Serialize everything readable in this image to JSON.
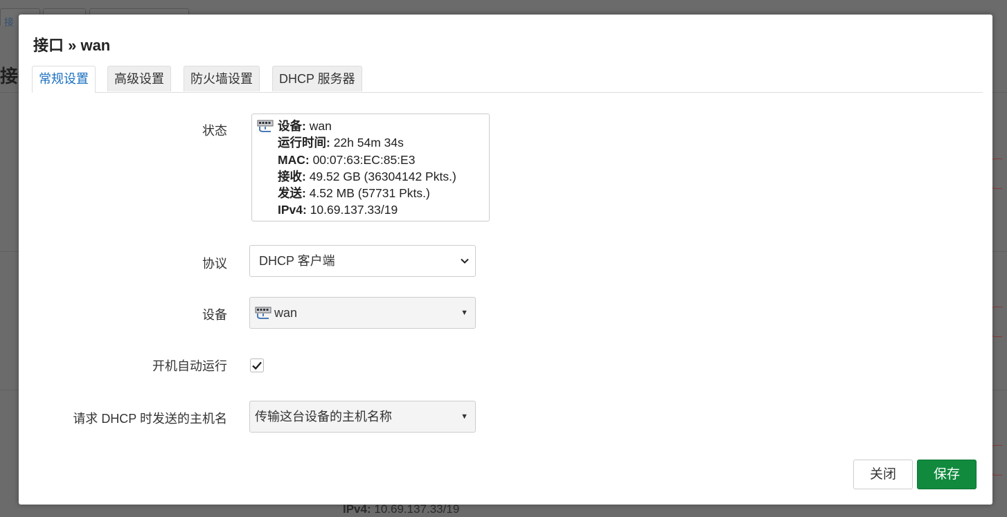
{
  "background": {
    "tab_fragment": "接",
    "page_title_fragment": "接",
    "ipv4_label": "IPv4:",
    "ipv4_value": "10.69.137.33/19"
  },
  "modal": {
    "title": "接口 » wan",
    "tabs": [
      {
        "label": "常规设置",
        "active": true
      },
      {
        "label": "高级设置",
        "active": false
      },
      {
        "label": "防火墙设置",
        "active": false
      },
      {
        "label": "DHCP 服务器",
        "active": false
      }
    ],
    "status": {
      "label": "状态",
      "icon": "ethernet-port-icon",
      "lines": [
        {
          "key": "设备:",
          "value": "wan"
        },
        {
          "key": "运行时间:",
          "value": "22h 54m 34s"
        },
        {
          "key": "MAC:",
          "value": "00:07:63:EC:85:E3"
        },
        {
          "key": "接收:",
          "value": "49.52 GB (36304142 Pkts.)"
        },
        {
          "key": "发送:",
          "value": "4.52 MB (57731 Pkts.)"
        },
        {
          "key": "IPv4:",
          "value": "10.69.137.33/19"
        }
      ]
    },
    "protocol": {
      "label": "协议",
      "value": "DHCP 客户端"
    },
    "device": {
      "label": "设备",
      "value": "wan",
      "icon": "ethernet-port-icon"
    },
    "autostart": {
      "label": "开机自动运行",
      "checked": true
    },
    "hostname": {
      "label": "请求 DHCP 时发送的主机名",
      "value": "传输这台设备的主机名称"
    },
    "buttons": {
      "close": "关闭",
      "save": "保存"
    },
    "colors": {
      "accent": "#1a6fc0",
      "save": "#118a3e"
    }
  }
}
